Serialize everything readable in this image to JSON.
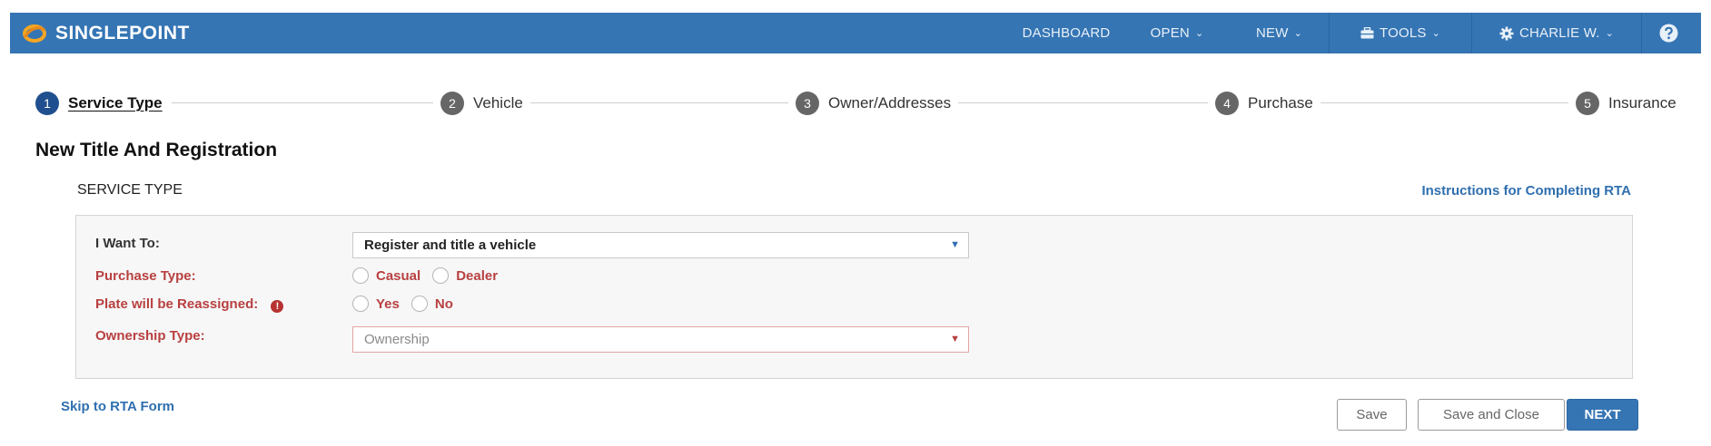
{
  "nav": {
    "brand": "SINGLEPOINT",
    "items": [
      {
        "label": "DASHBOARD"
      },
      {
        "label": "OPEN"
      },
      {
        "label": "NEW"
      },
      {
        "label": "TOOLS",
        "icon": "toolbox-icon"
      },
      {
        "label": "CHARLIE W.",
        "icon": "gear-icon"
      }
    ],
    "help_icon": "help-icon",
    "colors": {
      "bar": "#3575b4"
    }
  },
  "stepper": [
    {
      "num": "1",
      "label": "Service Type",
      "active": true
    },
    {
      "num": "2",
      "label": "Vehicle"
    },
    {
      "num": "3",
      "label": "Owner/Addresses"
    },
    {
      "num": "4",
      "label": "Purchase"
    },
    {
      "num": "5",
      "label": "Insurance"
    }
  ],
  "page": {
    "title": "New Title And Registration",
    "section": "SERVICE TYPE",
    "instructions_link": "Instructions for Completing RTA"
  },
  "form": {
    "want_to": {
      "label": "I Want To:",
      "value": "Register and title a vehicle"
    },
    "purchase_type": {
      "label": "Purchase Type:",
      "options": [
        "Casual",
        "Dealer"
      ]
    },
    "plate_reassigned": {
      "label": "Plate will be Reassigned:",
      "options": [
        "Yes",
        "No"
      ],
      "info_icon": "info-icon"
    },
    "ownership_type": {
      "label": "Ownership Type:",
      "placeholder": "Ownership"
    }
  },
  "actions": {
    "skip": "Skip to RTA Form",
    "save": "Save",
    "save_close": "Save and Close",
    "next": "NEXT"
  }
}
